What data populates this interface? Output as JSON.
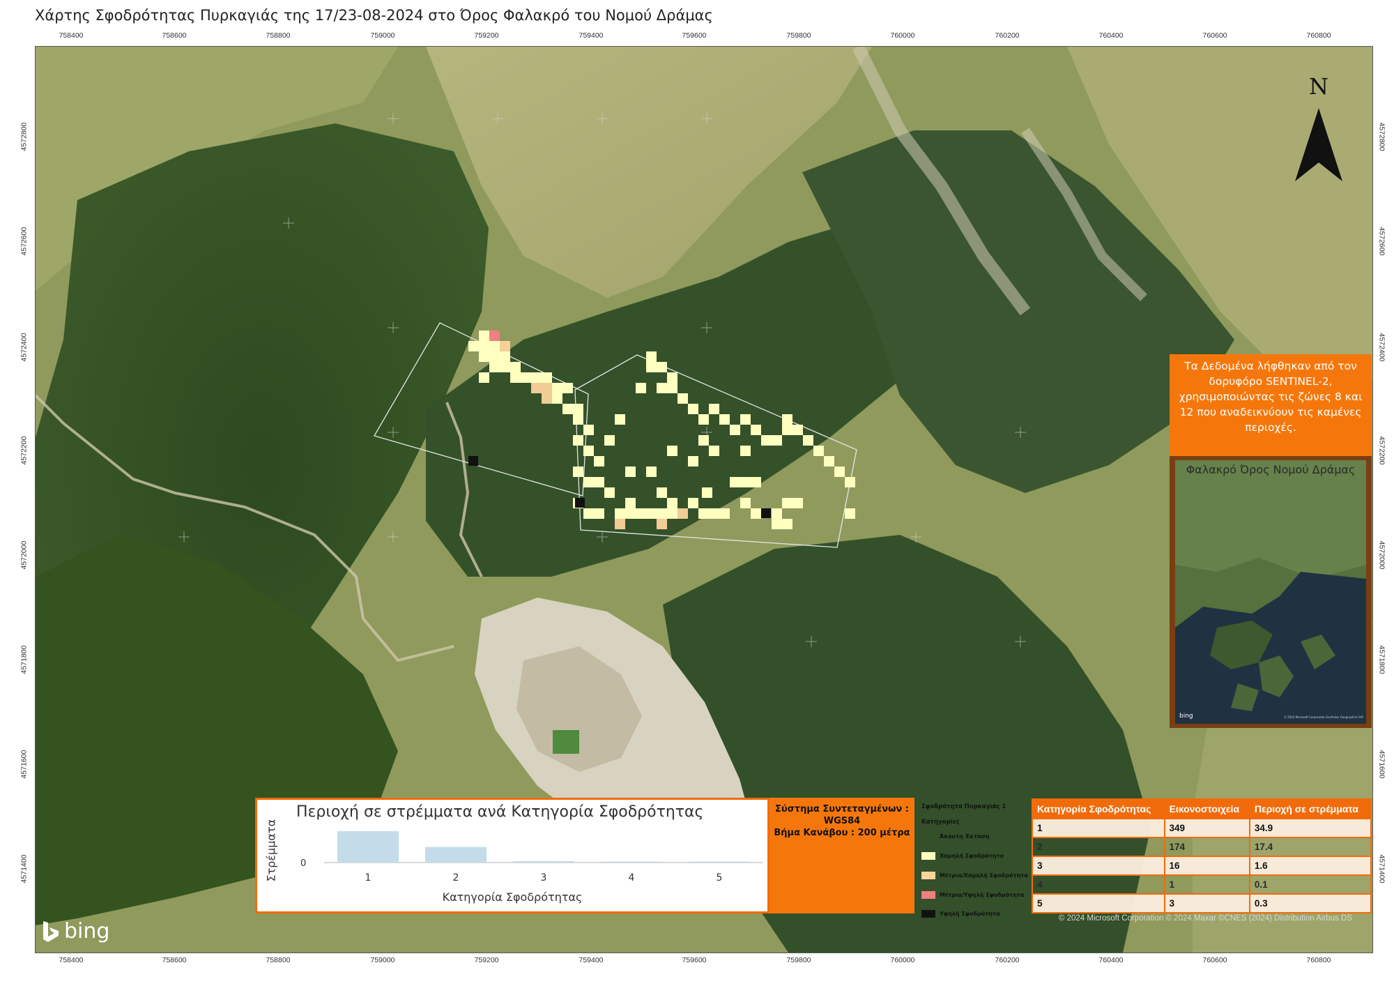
{
  "title": "Χάρτης Σφοδρότητας Πυρκαγιάς της 17/23-08-2024 στο Όρος Φαλακρό του Νομού Δράμας",
  "x_ticks": [
    "758400",
    "758600",
    "758800",
    "759000",
    "759200",
    "759400",
    "759600",
    "759800",
    "760000",
    "760200",
    "760400",
    "760600",
    "760800"
  ],
  "y_ticks": [
    "4572600",
    "4572400",
    "4572200",
    "4572000",
    "4571800",
    "4571600",
    "4571400",
    "4572800"
  ],
  "north_label": "N",
  "info_box": {
    "text": "Τα Δεδομένα λήφθηκαν από τον δορυφόρο SENTINEL-2, χρησιμοποιώντας τις ζώνες 8 και 12 που αναδεικνύουν τις καμένες περιοχές."
  },
  "inset": {
    "title": "Φαλακρό Όρος Νομού Δράμας",
    "logo": "bing",
    "attribution": "© 2024 Microsoft Corporation Earthstar Geographics SIO"
  },
  "chart_data": {
    "type": "bar",
    "title": "Περιοχή σε στρέμματα ανά Κατηγορία Σφοδρότητας",
    "xlabel": "Κατηγορία Σφοδρότητας",
    "ylabel": "Στρέμματα",
    "categories": [
      "1",
      "2",
      "3",
      "4",
      "5"
    ],
    "values": [
      34.9,
      17.4,
      1.6,
      0.1,
      0.3
    ],
    "y_tick_labels": [
      "0"
    ],
    "bar_color": "#c4dcea"
  },
  "coord_box": {
    "line1": "Σύστημα Συντεταγμένων :",
    "line2": "WGS84",
    "line3": "Βήμα Κανάβου : 200 μέτρα"
  },
  "legend": {
    "title": "Σφοδρότητα Πυρκαγιάς 1",
    "subtitle": "Κατηγορίες",
    "items": [
      {
        "label": "Άκαυτη Έκταση",
        "color": "transparent"
      },
      {
        "label": "Χαμηλή Σφοδρότητα",
        "color": "#ffffc0"
      },
      {
        "label": "Μέτρια/Χαμηλή Σφοδρότητα",
        "color": "#fcd39a"
      },
      {
        "label": "Μέτρια/Υψηλή Σφοδρότητα",
        "color": "#f08080"
      },
      {
        "label": "Υψηλή Σφοδρότητα",
        "color": "#111111"
      }
    ]
  },
  "stats_table": {
    "headers": [
      "Κατηγορία Σφοδρότητας",
      "Εικονοστοιχεία",
      "Περιοχή σε στρέμματα"
    ],
    "rows": [
      [
        "1",
        "349",
        "34.9"
      ],
      [
        "2",
        "174",
        "17.4"
      ],
      [
        "3",
        "16",
        "1.6"
      ],
      [
        "4",
        "1",
        "0.1"
      ],
      [
        "5",
        "3",
        "0.3"
      ]
    ]
  },
  "attribution": "© 2024 Microsoft Corporation © 2024 Maxar ©CNES (2024) Distribution Airbus DS",
  "bing_logo": "bing",
  "colors": {
    "accent_orange": "#f26b0a",
    "low_severity": "#ffffc0",
    "moderate_low": "#fcd39a",
    "moderate_high": "#f08080",
    "high": "#111111"
  }
}
